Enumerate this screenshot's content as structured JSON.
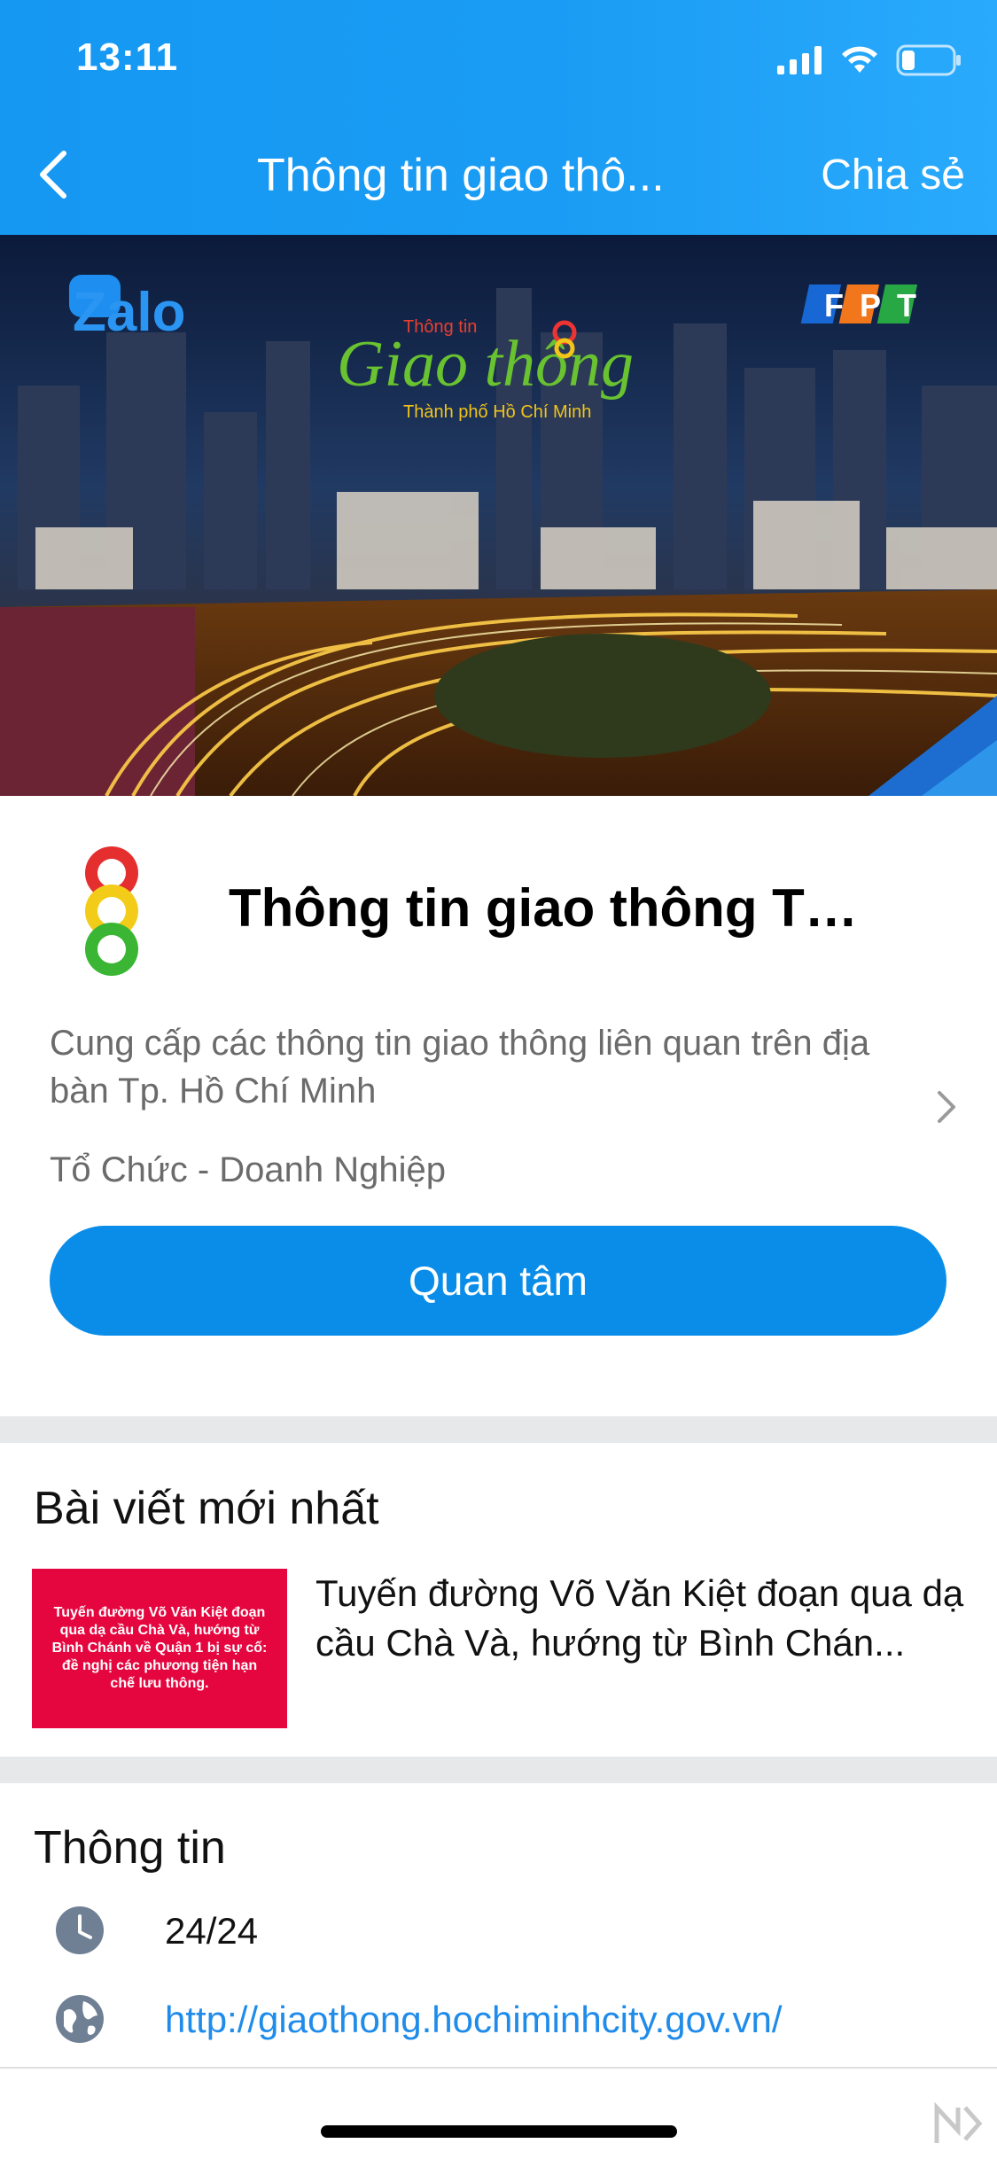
{
  "status_bar": {
    "time": "13:11"
  },
  "header": {
    "title": "Thông tin giao thô...",
    "share_label": "Chia sẻ"
  },
  "banner": {
    "zalo_logo": "Zalo",
    "fpt_logo": "FPT",
    "title_small": "Thông tin",
    "title_big": "Giao thông",
    "subtitle": "Thành phố Hồ Chí Minh"
  },
  "profile": {
    "name": "Thông tin giao thông Tp...",
    "description": "Cung cấp các thông tin giao thông liên quan trên địa bàn Tp. Hồ Chí Minh",
    "category": "Tổ Chức - Doanh Nghiệp",
    "follow_label": "Quan tâm"
  },
  "latest_posts": {
    "title": "Bài viết mới nhất",
    "items": [
      {
        "thumb_text": "Tuyến đường Võ Văn Kiệt đoạn qua dạ cầu Chà Và, hướng từ Bình Chánh về Quận 1 bị sự cố: đề nghị các phương tiện hạn chế lưu thông.",
        "title": "Tuyến đường Võ Văn Kiệt đoạn qua dạ cầu Chà Và, hướng từ Bình Chán..."
      }
    ]
  },
  "info": {
    "title": "Thông tin",
    "hours": "24/24",
    "website": "http://giaothong.hochiminhcity.gov.vn/"
  },
  "colors": {
    "header": "#1a9cf4",
    "button": "#0a8de8",
    "link": "#1f8bea",
    "thumb": "#e5063f"
  },
  "icons": [
    "back-icon",
    "signal-icon",
    "wifi-icon",
    "battery-icon",
    "traffic-light-icon",
    "chevron-right-icon",
    "clock-icon",
    "globe-icon"
  ]
}
